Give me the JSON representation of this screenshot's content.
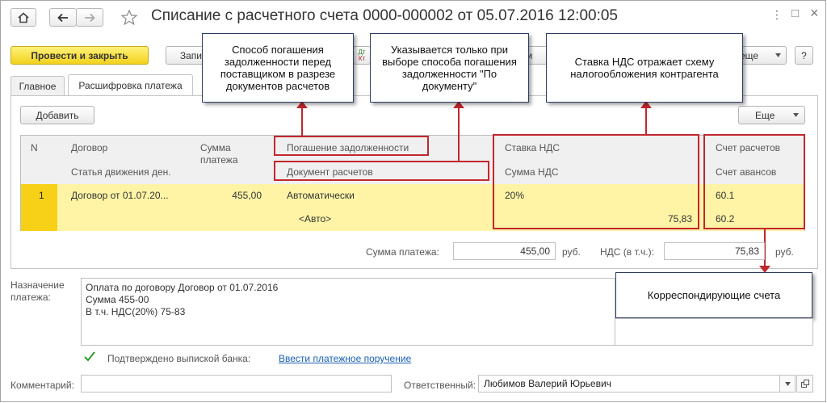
{
  "window": {
    "title": "Списание с расчетного счета 0000-000002 от 05.07.2016 12:00:05",
    "home_icon": "home-icon",
    "back_icon": "arrow-left-icon",
    "forward_icon": "arrow-right-icon",
    "favorite_icon": "star-icon",
    "more_icon": "vertical-dots-icon",
    "maximize_icon": "maximize-icon",
    "close_icon": "close-icon",
    "more_glyph": "⋮",
    "maximize_glyph": "□",
    "close_glyph": "×"
  },
  "toolbar": {
    "post_close_label": "Провести и закрыть",
    "save_label": "Запи",
    "dtkt_top": "Дт",
    "dtkt_bottom": "Кт",
    "partial_label": "сти",
    "more_label": "еще",
    "help_label": "?"
  },
  "tabs": [
    {
      "label": "Главное"
    },
    {
      "label": "Расшифровка платежа"
    }
  ],
  "table": {
    "add_label": "Добавить",
    "more_label": "Еще",
    "headers": {
      "n": "N",
      "contract": "Договор",
      "cash_flow_item": "Статья движения ден.",
      "payment_amount_line1": "Сумма",
      "payment_amount_line2": "платежа",
      "debt_repayment": "Погашение задолженности",
      "settlement_document": "Документ расчетов",
      "vat_rate": "Ставка НДС",
      "vat_amount": "Сумма НДС",
      "settlement_account": "Счет расчетов",
      "advance_account": "Счет авансов"
    },
    "rows": [
      {
        "n": "1",
        "contract": "Договор от 01.07.20...",
        "amount": "455,00",
        "debt_repayment": "Автоматически",
        "settlement_document": "<Авто>",
        "vat_rate": "20%",
        "vat_amount": "75,83",
        "settlement_account": "60.1",
        "advance_account": "60.2"
      }
    ]
  },
  "callouts": {
    "repayment_method": "Способ погашения задолженности перед поставщиком в разрезе документов расчетов",
    "by_document": "Указывается только при выборе способа погашения задолженности \"По документу\"",
    "vat_scheme": "Ставка НДС отражает схему налогообложения контрагента",
    "correspondent": "Корреспондирующие счета"
  },
  "totals": {
    "payment_amount_label": "Сумма платежа:",
    "payment_amount_value": "455,00",
    "currency1": "руб.",
    "vat_label": "НДС (в т.ч.):",
    "vat_value": "75,83",
    "currency2": "руб."
  },
  "purpose": {
    "label_line1": "Назначение",
    "label_line2": "платежа:",
    "line1": "Оплата по договору Договор от 01.07.2016",
    "line2": "Сумма 455-00",
    "line3": "В т.ч. НДС(20%) 75-83"
  },
  "bank": {
    "checked": true,
    "confirmed_label": "Подтверждено выпиской банка:",
    "link_label": "Ввести платежное поручение"
  },
  "footer": {
    "comment_label": "Комментарий:",
    "comment_value": "",
    "responsible_label": "Ответственный:",
    "responsible_value": "Любимов Валерий Юрьевич"
  },
  "colors": {
    "accent_yellow": "#f2d21d",
    "highlight_red": "#c1272d",
    "row_yellow": "#fff4a6",
    "link_blue": "#1a5fb4"
  }
}
